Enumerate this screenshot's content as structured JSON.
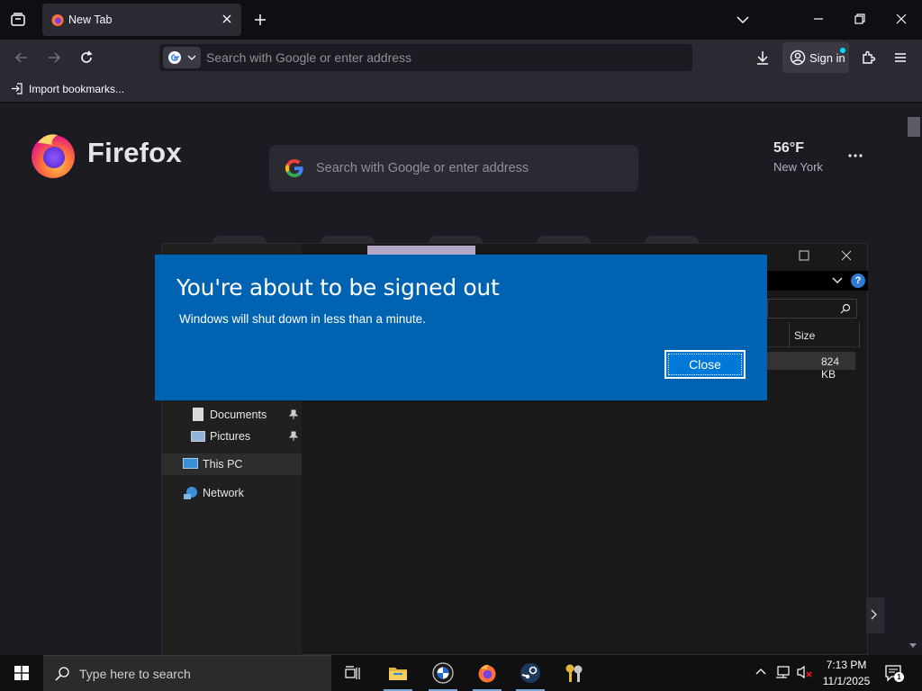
{
  "browser": {
    "tab_title": "New Tab",
    "url_placeholder": "Search with Google or enter address",
    "sign_in_label": "Sign in",
    "import_bookmarks_label": "Import bookmarks..."
  },
  "newtab": {
    "brand": "Firefox",
    "search_placeholder": "Search with Google or enter address",
    "weather_temp": "56°F",
    "weather_city": "New York"
  },
  "explorer": {
    "nav_items": [
      {
        "label": "Documents",
        "icon": "document-icon",
        "pinned": true
      },
      {
        "label": "Pictures",
        "icon": "pictures-icon",
        "pinned": true
      },
      {
        "label": "This PC",
        "icon": "computer-icon",
        "pinned": false
      },
      {
        "label": "Network",
        "icon": "network-icon",
        "pinned": false
      }
    ],
    "column_size": "Size",
    "row_size": "824 KB"
  },
  "modal": {
    "title": "You're about to be signed out",
    "message": "Windows will shut down in less than a minute.",
    "close_label": "Close",
    "bg_color": "#0063b1"
  },
  "taskbar": {
    "search_placeholder": "Type here to search",
    "time": "7:13 PM",
    "date": "11/1/2025",
    "notification_count": "1"
  }
}
